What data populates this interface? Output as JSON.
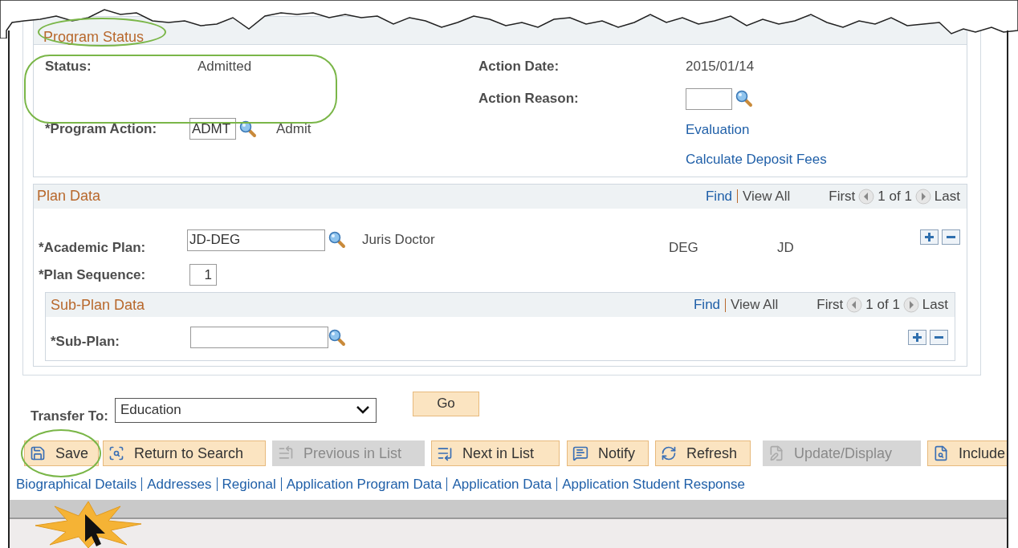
{
  "program_status": {
    "title": "Program Status",
    "status_label": "Status:",
    "status_value": "Admitted",
    "action_label": "*Program Action:",
    "action_value": "ADMT",
    "action_desc": "Admit",
    "date_label": "Action Date:",
    "date_value": "2015/01/14",
    "reason_label": "Action Reason:",
    "links": [
      "Evaluation",
      "Calculate Deposit Fees"
    ]
  },
  "plan_data": {
    "title": "Plan Data",
    "find": "Find",
    "view_all": "View All",
    "first": "First",
    "count": "1 of 1",
    "last": "Last",
    "plan_label": "*Academic Plan:",
    "plan_value": "JD-DEG",
    "plan_desc": "Juris Doctor",
    "col_a": "DEG",
    "col_b": "JD",
    "seq_label": "*Plan Sequence:",
    "seq_value": "1",
    "sub_plan": {
      "title": "Sub-Plan Data",
      "find": "Find",
      "view_all": "View All",
      "first": "First",
      "count": "1 of 1",
      "last": "Last",
      "label": "*Sub-Plan:"
    }
  },
  "transfer": {
    "label": "Transfer To:",
    "value": "Education",
    "go": "Go"
  },
  "toolbar": [
    {
      "label": "Save",
      "kind": "save",
      "disabled": false
    },
    {
      "label": "Return to Search",
      "kind": "search",
      "disabled": false
    },
    {
      "label": "Previous in List",
      "kind": "previous",
      "disabled": true
    },
    {
      "label": "Next in List",
      "kind": "next",
      "disabled": false
    },
    {
      "label": "Notify",
      "kind": "notify",
      "disabled": false
    },
    {
      "label": "Refresh",
      "kind": "refresh",
      "disabled": false
    },
    {
      "label": "Update/Display",
      "kind": "update",
      "disabled": true
    },
    {
      "label": "Include",
      "kind": "include",
      "disabled": false
    }
  ],
  "links": [
    "Biographical Details",
    "Addresses",
    "Regional",
    "Application Program Data",
    "Application Data",
    "Application Student Response"
  ]
}
